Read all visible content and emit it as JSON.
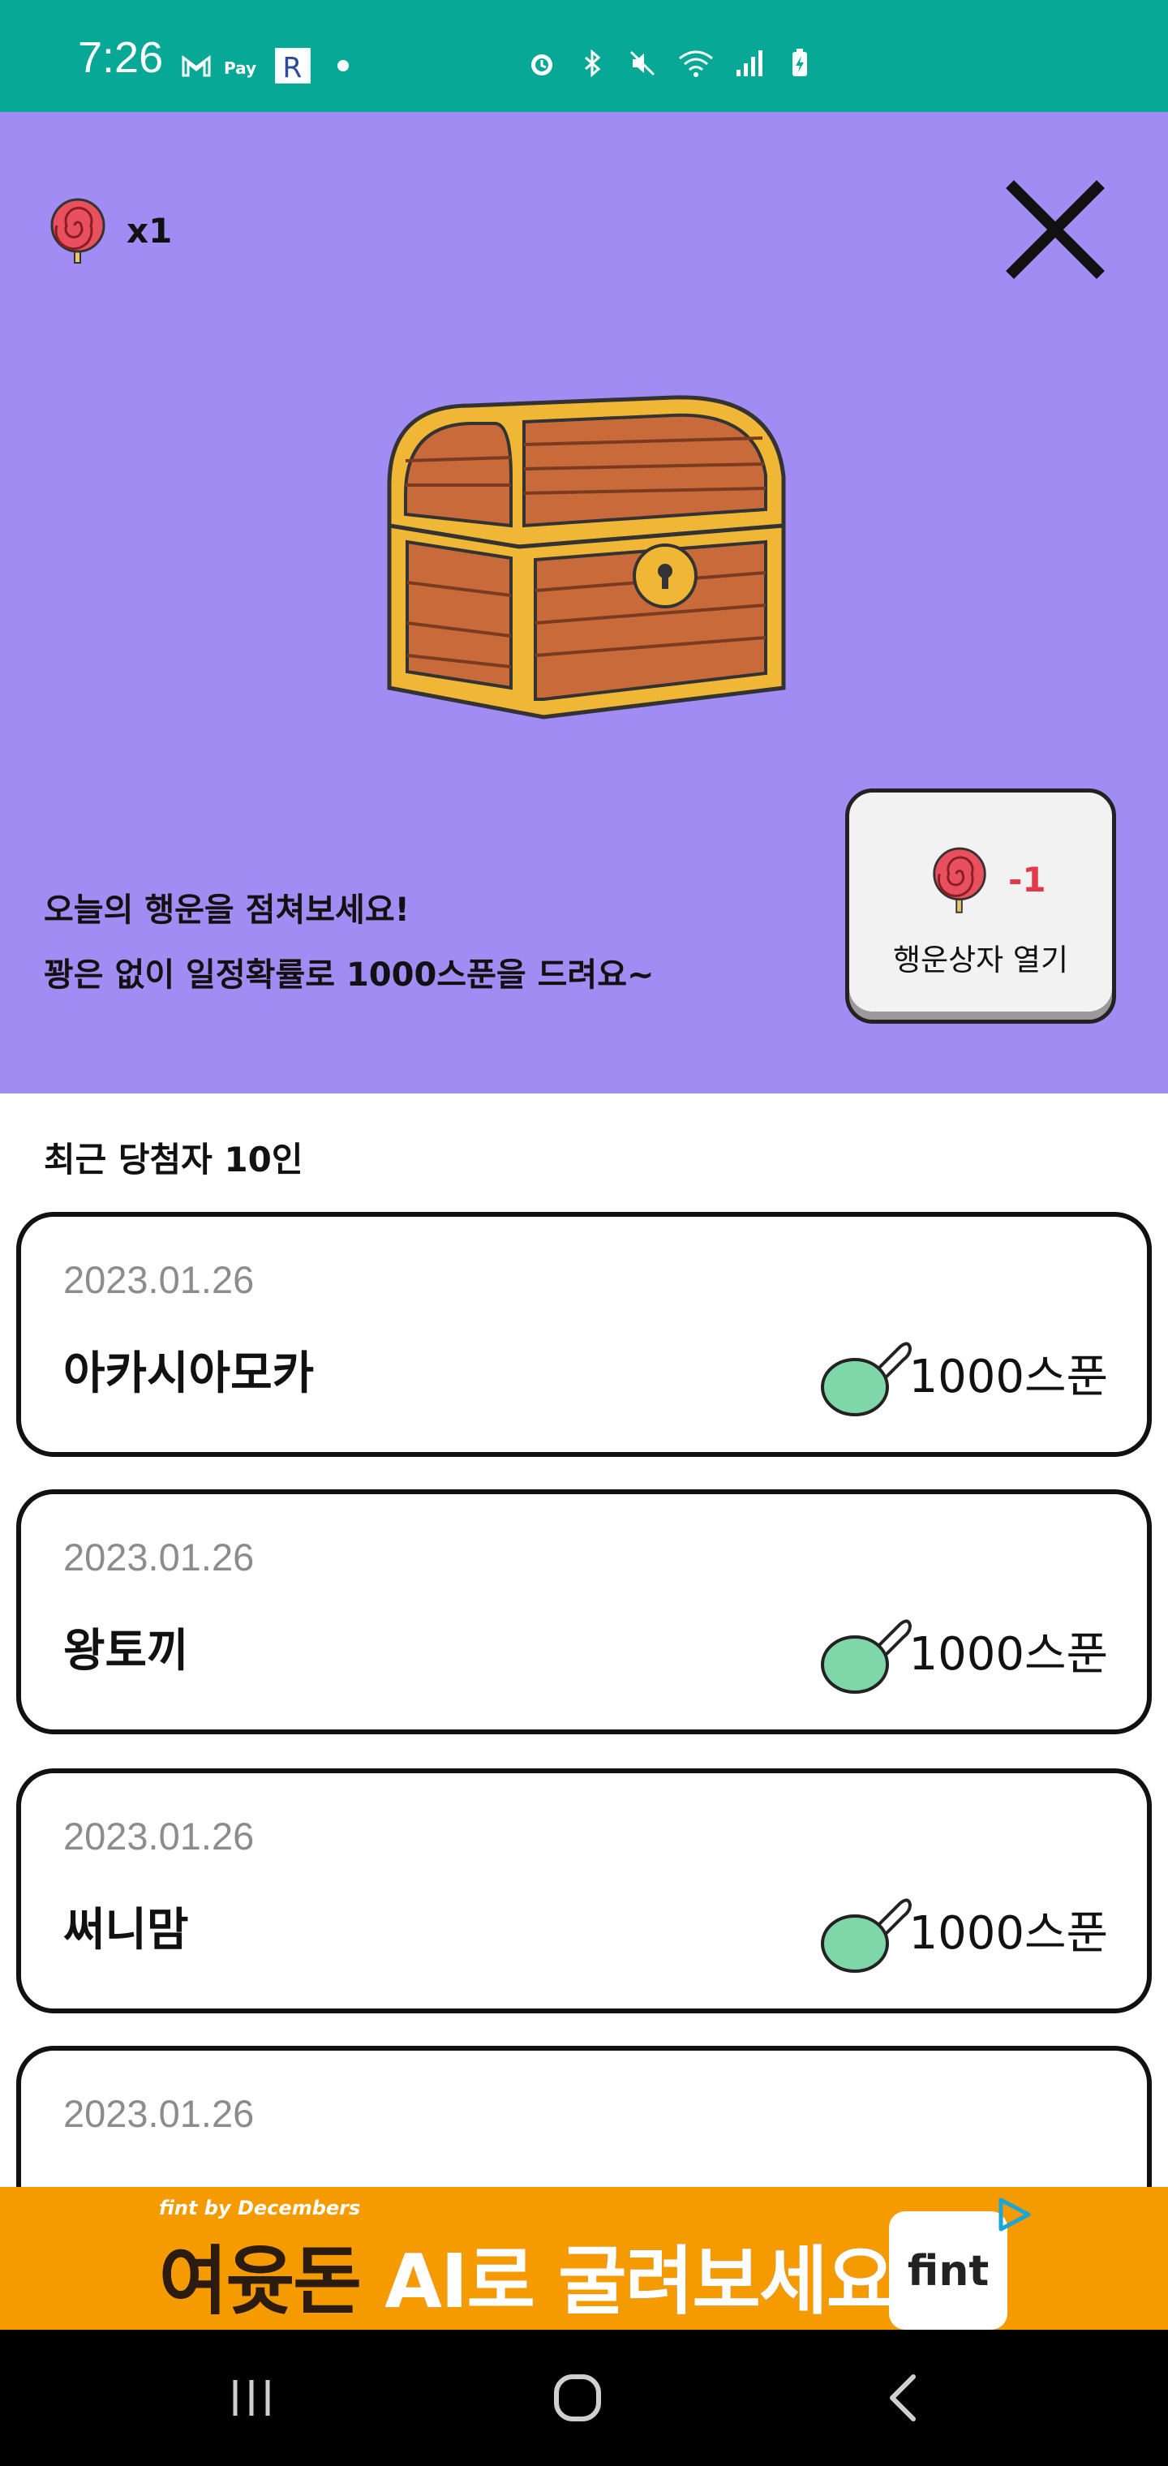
{
  "status_bar": {
    "time": "7:26",
    "left_icons": [
      "gmail-icon",
      "npay-icon",
      "r-app-icon"
    ],
    "right_icons": [
      "alarm-icon",
      "bluetooth-icon",
      "mute-icon",
      "wifi-icon",
      "signal-icon",
      "battery-charging-icon"
    ]
  },
  "hero": {
    "candy_count": "x1",
    "line1": "오늘의 행운을 점쳐보세요!",
    "line2": "꽝은 없이 일정확률로 1000스푼을 드려요~",
    "open_button": {
      "cost": "-1",
      "label": "행운상자 열기"
    }
  },
  "winners": {
    "title": "최근 당첨자 10인",
    "items": [
      {
        "date": "2023.01.26",
        "name": "아카시아모카",
        "amount": "1000스푼"
      },
      {
        "date": "2023.01.26",
        "name": "왕토끼",
        "amount": "1000스푼"
      },
      {
        "date": "2023.01.26",
        "name": "써니맘",
        "amount": "1000스푼"
      },
      {
        "date": "2023.01.26",
        "name": "",
        "amount": ""
      }
    ]
  },
  "ad": {
    "brand_small": "fint by Decembers",
    "headline_dark": "여윳돈",
    "headline_light": " AI로 굴려보세요!",
    "logo": "fint"
  },
  "colors": {
    "status_bar": "#07a996",
    "hero_bg": "#a08cf3",
    "cost_red": "#e13a4b",
    "ad_bg": "#f59b00"
  }
}
